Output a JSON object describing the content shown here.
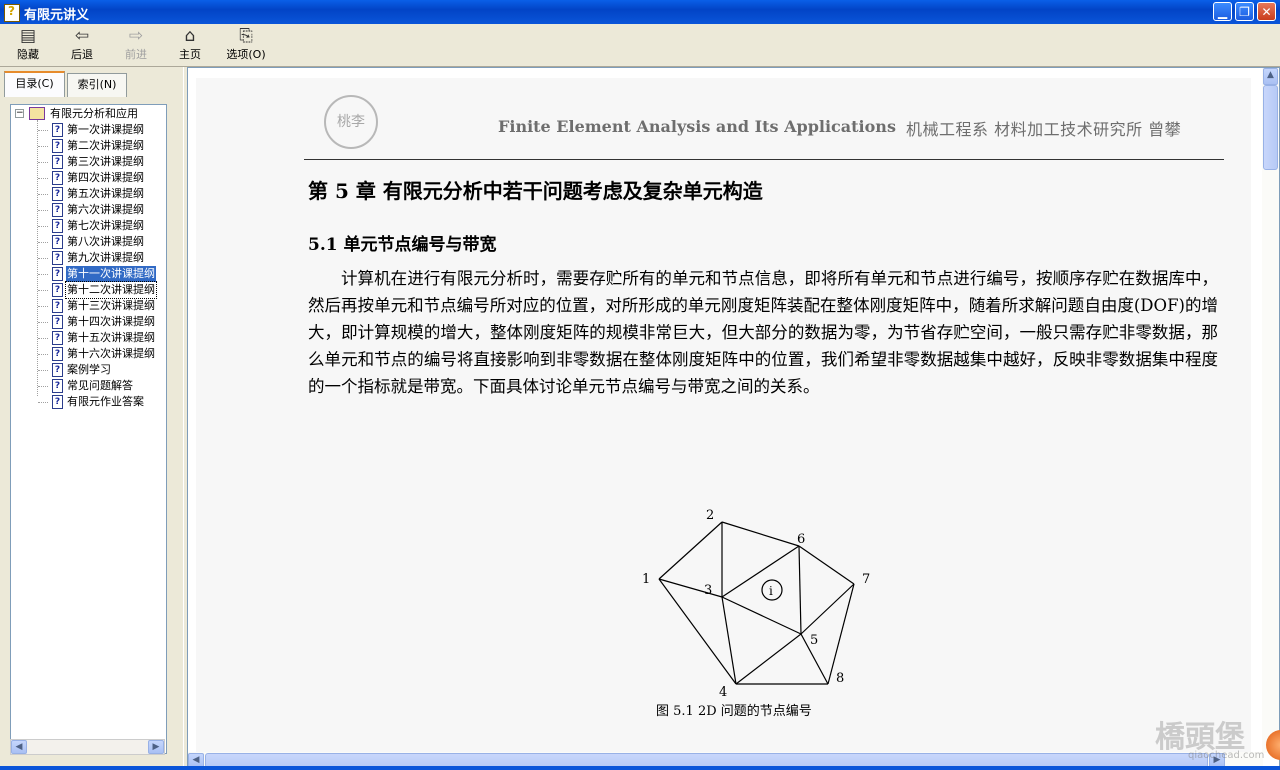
{
  "window": {
    "title": "有限元讲义"
  },
  "toolbar": {
    "hide_label": "隐藏",
    "back_label": "后退",
    "forward_label": "前进",
    "home_label": "主页",
    "options_label": "选项(O)"
  },
  "tabs": {
    "contents_label": "目录(C)",
    "index_label": "索引(N)"
  },
  "tree": {
    "root": "有限元分析和应用",
    "items": [
      "第一次讲课提纲",
      "第二次讲课提纲",
      "第三次讲课提纲",
      "第四次讲课提纲",
      "第五次讲课提纲",
      "第六次讲课提纲",
      "第七次讲课提纲",
      "第八次讲课提纲",
      "第九次讲课提纲",
      "第十一次讲课提纲",
      "第十二次讲课提纲",
      "第十三次讲课提纲",
      "第十四次讲课提纲",
      "第十五次讲课提纲",
      "第十六次讲课提纲",
      "案例学习",
      "常见问题解答",
      "有限元作业答案"
    ],
    "selected_index": 9
  },
  "page": {
    "seal_text": "桃李",
    "header_en": "Finite Element Analysis and Its Applications",
    "header_cn": "机械工程系  材料加工技术研究所    曾攀",
    "chapter": "第 5 章  有限元分析中若干问题考虑及复杂单元构造",
    "section": "5.1  单元节点编号与带宽",
    "paragraph": "计算机在进行有限元分析时，需要存贮所有的单元和节点信息，即将所有单元和节点进行编号，按顺序存贮在数据库中，然后再按单元和节点编号所对应的位置，对所形成的单元刚度矩阵装配在整体刚度矩阵中，随着所求解问题自由度(DOF)的增大，即计算规模的增大，整体刚度矩阵的规模非常巨大，但大部分的数据为零，为节省存贮空间，一般只需存贮非零数据，那么单元和节点的编号将直接影响到非零数据在整体刚度矩阵中的位置，我们希望非零数据越集中越好，反映非零数据集中程度的一个指标就是带宽。下面具体讨论单元节点编号与带宽之间的关系。",
    "figure": {
      "node_labels": [
        "1",
        "2",
        "3",
        "4",
        "5",
        "6",
        "7",
        "8"
      ],
      "element_label": "i",
      "caption": "图 5.1    2D 问题的节点编号"
    }
  },
  "watermark": {
    "text": "橋頭堡",
    "small": "qiaochead.com"
  }
}
